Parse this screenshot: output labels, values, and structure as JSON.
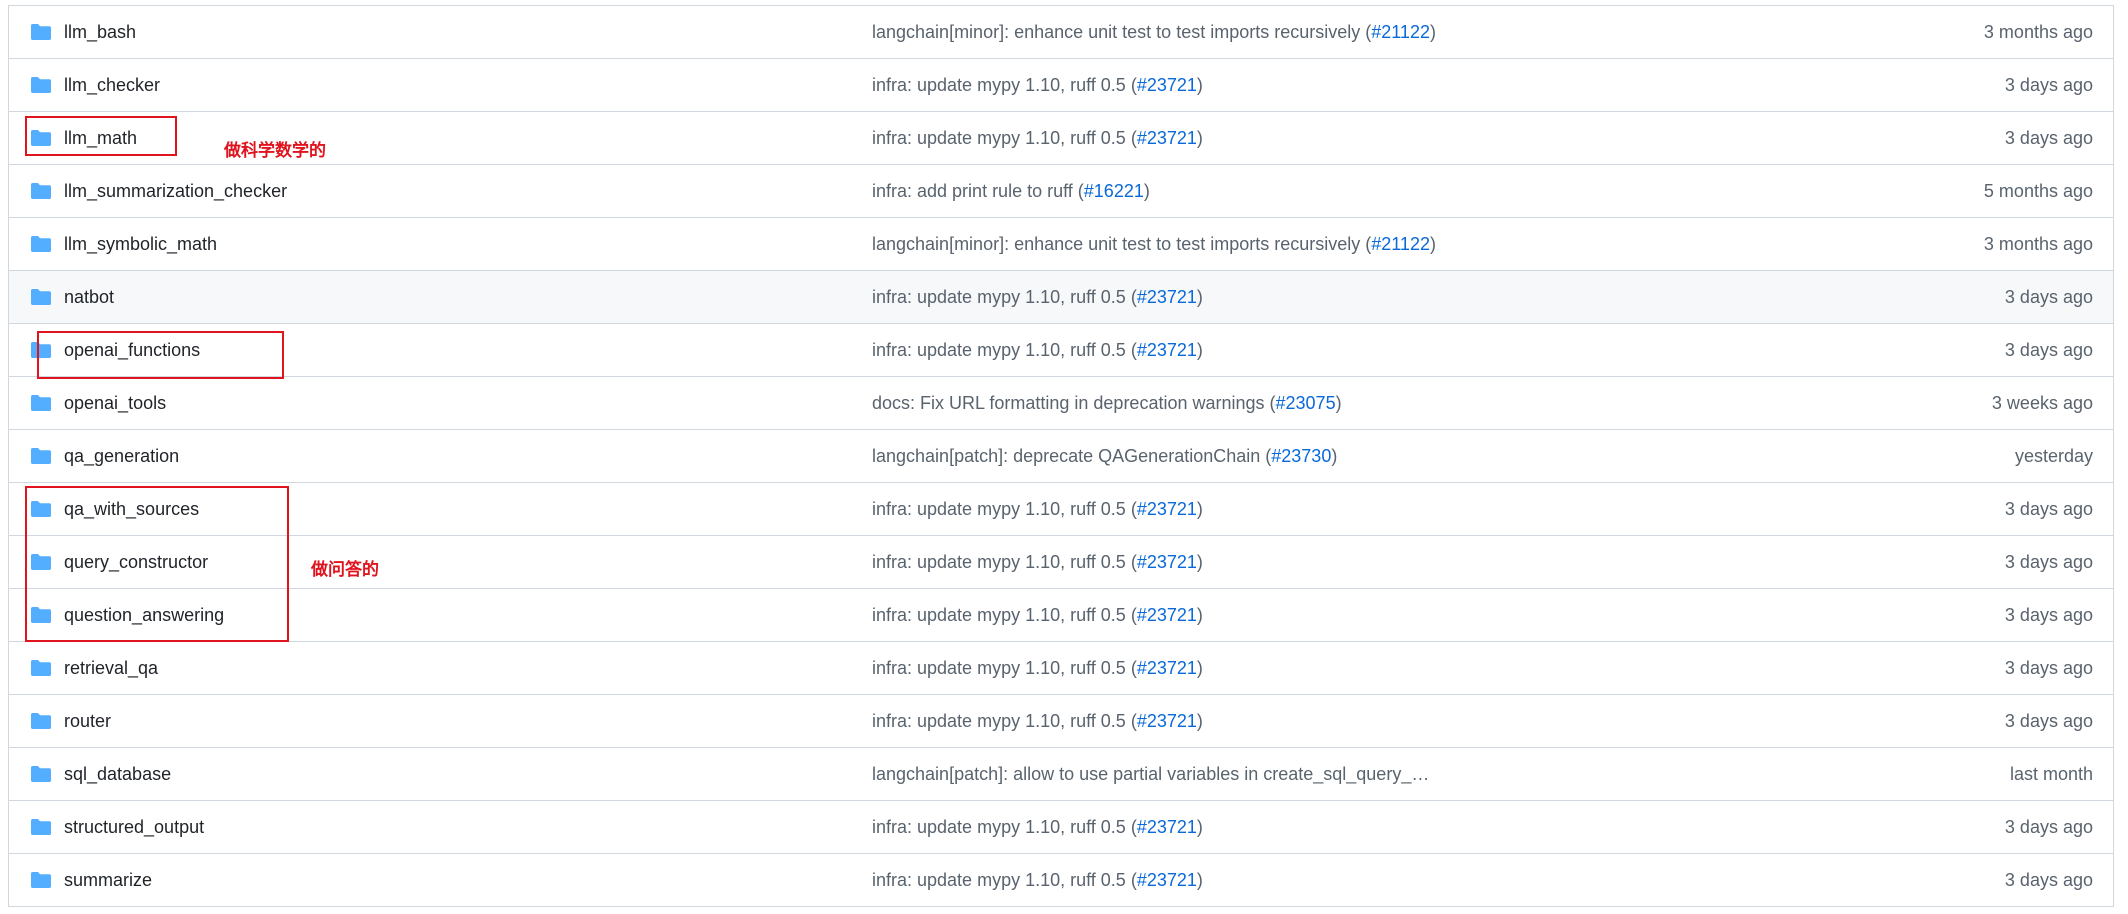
{
  "colors": {
    "folder": "#54aeff",
    "link": "#0969da",
    "muted": "#59636e",
    "annotation": "#e0141e",
    "border": "#d0d7de",
    "hover_row": "#f6f8fa"
  },
  "rows": [
    {
      "name": "llm_bash",
      "icon": "folder-icon",
      "commit_text": "langchain[minor]: enhance unit test to test imports recursively (",
      "commit_pr": "#21122",
      "commit_close": ")",
      "age": "3 months ago"
    },
    {
      "name": "llm_checker",
      "icon": "folder-icon",
      "commit_text": "infra: update mypy 1.10, ruff 0.5 (",
      "commit_pr": "#23721",
      "commit_close": ")",
      "age": "3 days ago"
    },
    {
      "name": "llm_math",
      "icon": "folder-icon",
      "commit_text": "infra: update mypy 1.10, ruff 0.5 (",
      "commit_pr": "#23721",
      "commit_close": ")",
      "age": "3 days ago"
    },
    {
      "name": "llm_summarization_checker",
      "icon": "folder-icon",
      "commit_text": "infra: add print rule to ruff (",
      "commit_pr": "#16221",
      "commit_close": ")",
      "age": "5 months ago"
    },
    {
      "name": "llm_symbolic_math",
      "icon": "folder-icon",
      "commit_text": "langchain[minor]: enhance unit test to test imports recursively (",
      "commit_pr": "#21122",
      "commit_close": ")",
      "age": "3 months ago"
    },
    {
      "name": "natbot",
      "icon": "folder-icon",
      "commit_text": "infra: update mypy 1.10, ruff 0.5 (",
      "commit_pr": "#23721",
      "commit_close": ")",
      "age": "3 days ago"
    },
    {
      "name": "openai_functions",
      "icon": "folder-icon",
      "commit_text": "infra: update mypy 1.10, ruff 0.5 (",
      "commit_pr": "#23721",
      "commit_close": ")",
      "age": "3 days ago"
    },
    {
      "name": "openai_tools",
      "icon": "folder-icon",
      "commit_text": "docs: Fix URL formatting in deprecation warnings (",
      "commit_pr": "#23075",
      "commit_close": ")",
      "age": "3 weeks ago"
    },
    {
      "name": "qa_generation",
      "icon": "folder-icon",
      "commit_text": "langchain[patch]: deprecate QAGenerationChain (",
      "commit_pr": "#23730",
      "commit_close": ")",
      "age": "yesterday"
    },
    {
      "name": "qa_with_sources",
      "icon": "folder-icon",
      "commit_text": "infra: update mypy 1.10, ruff 0.5 (",
      "commit_pr": "#23721",
      "commit_close": ")",
      "age": "3 days ago"
    },
    {
      "name": "query_constructor",
      "icon": "folder-icon",
      "commit_text": "infra: update mypy 1.10, ruff 0.5 (",
      "commit_pr": "#23721",
      "commit_close": ")",
      "age": "3 days ago"
    },
    {
      "name": "question_answering",
      "icon": "folder-icon",
      "commit_text": "infra: update mypy 1.10, ruff 0.5 (",
      "commit_pr": "#23721",
      "commit_close": ")",
      "age": "3 days ago"
    },
    {
      "name": "retrieval_qa",
      "icon": "folder-icon",
      "commit_text": "infra: update mypy 1.10, ruff 0.5 (",
      "commit_pr": "#23721",
      "commit_close": ")",
      "age": "3 days ago"
    },
    {
      "name": "router",
      "icon": "folder-icon",
      "commit_text": "infra: update mypy 1.10, ruff 0.5 (",
      "commit_pr": "#23721",
      "commit_close": ")",
      "age": "3 days ago"
    },
    {
      "name": "sql_database",
      "icon": "folder-icon",
      "commit_text": "langchain[patch]: allow to use partial variables in create_sql_query_…",
      "commit_pr": "",
      "commit_close": "",
      "age": "last month"
    },
    {
      "name": "structured_output",
      "icon": "folder-icon",
      "commit_text": "infra: update mypy 1.10, ruff 0.5 (",
      "commit_pr": "#23721",
      "commit_close": ")",
      "age": "3 days ago"
    },
    {
      "name": "summarize",
      "icon": "folder-icon",
      "commit_text": "infra: update mypy 1.10, ruff 0.5 (",
      "commit_pr": "#23721",
      "commit_close": ")",
      "age": "3 days ago"
    }
  ],
  "annotations": {
    "math_note": "做科学数学的",
    "qa_note": "做问答的"
  }
}
